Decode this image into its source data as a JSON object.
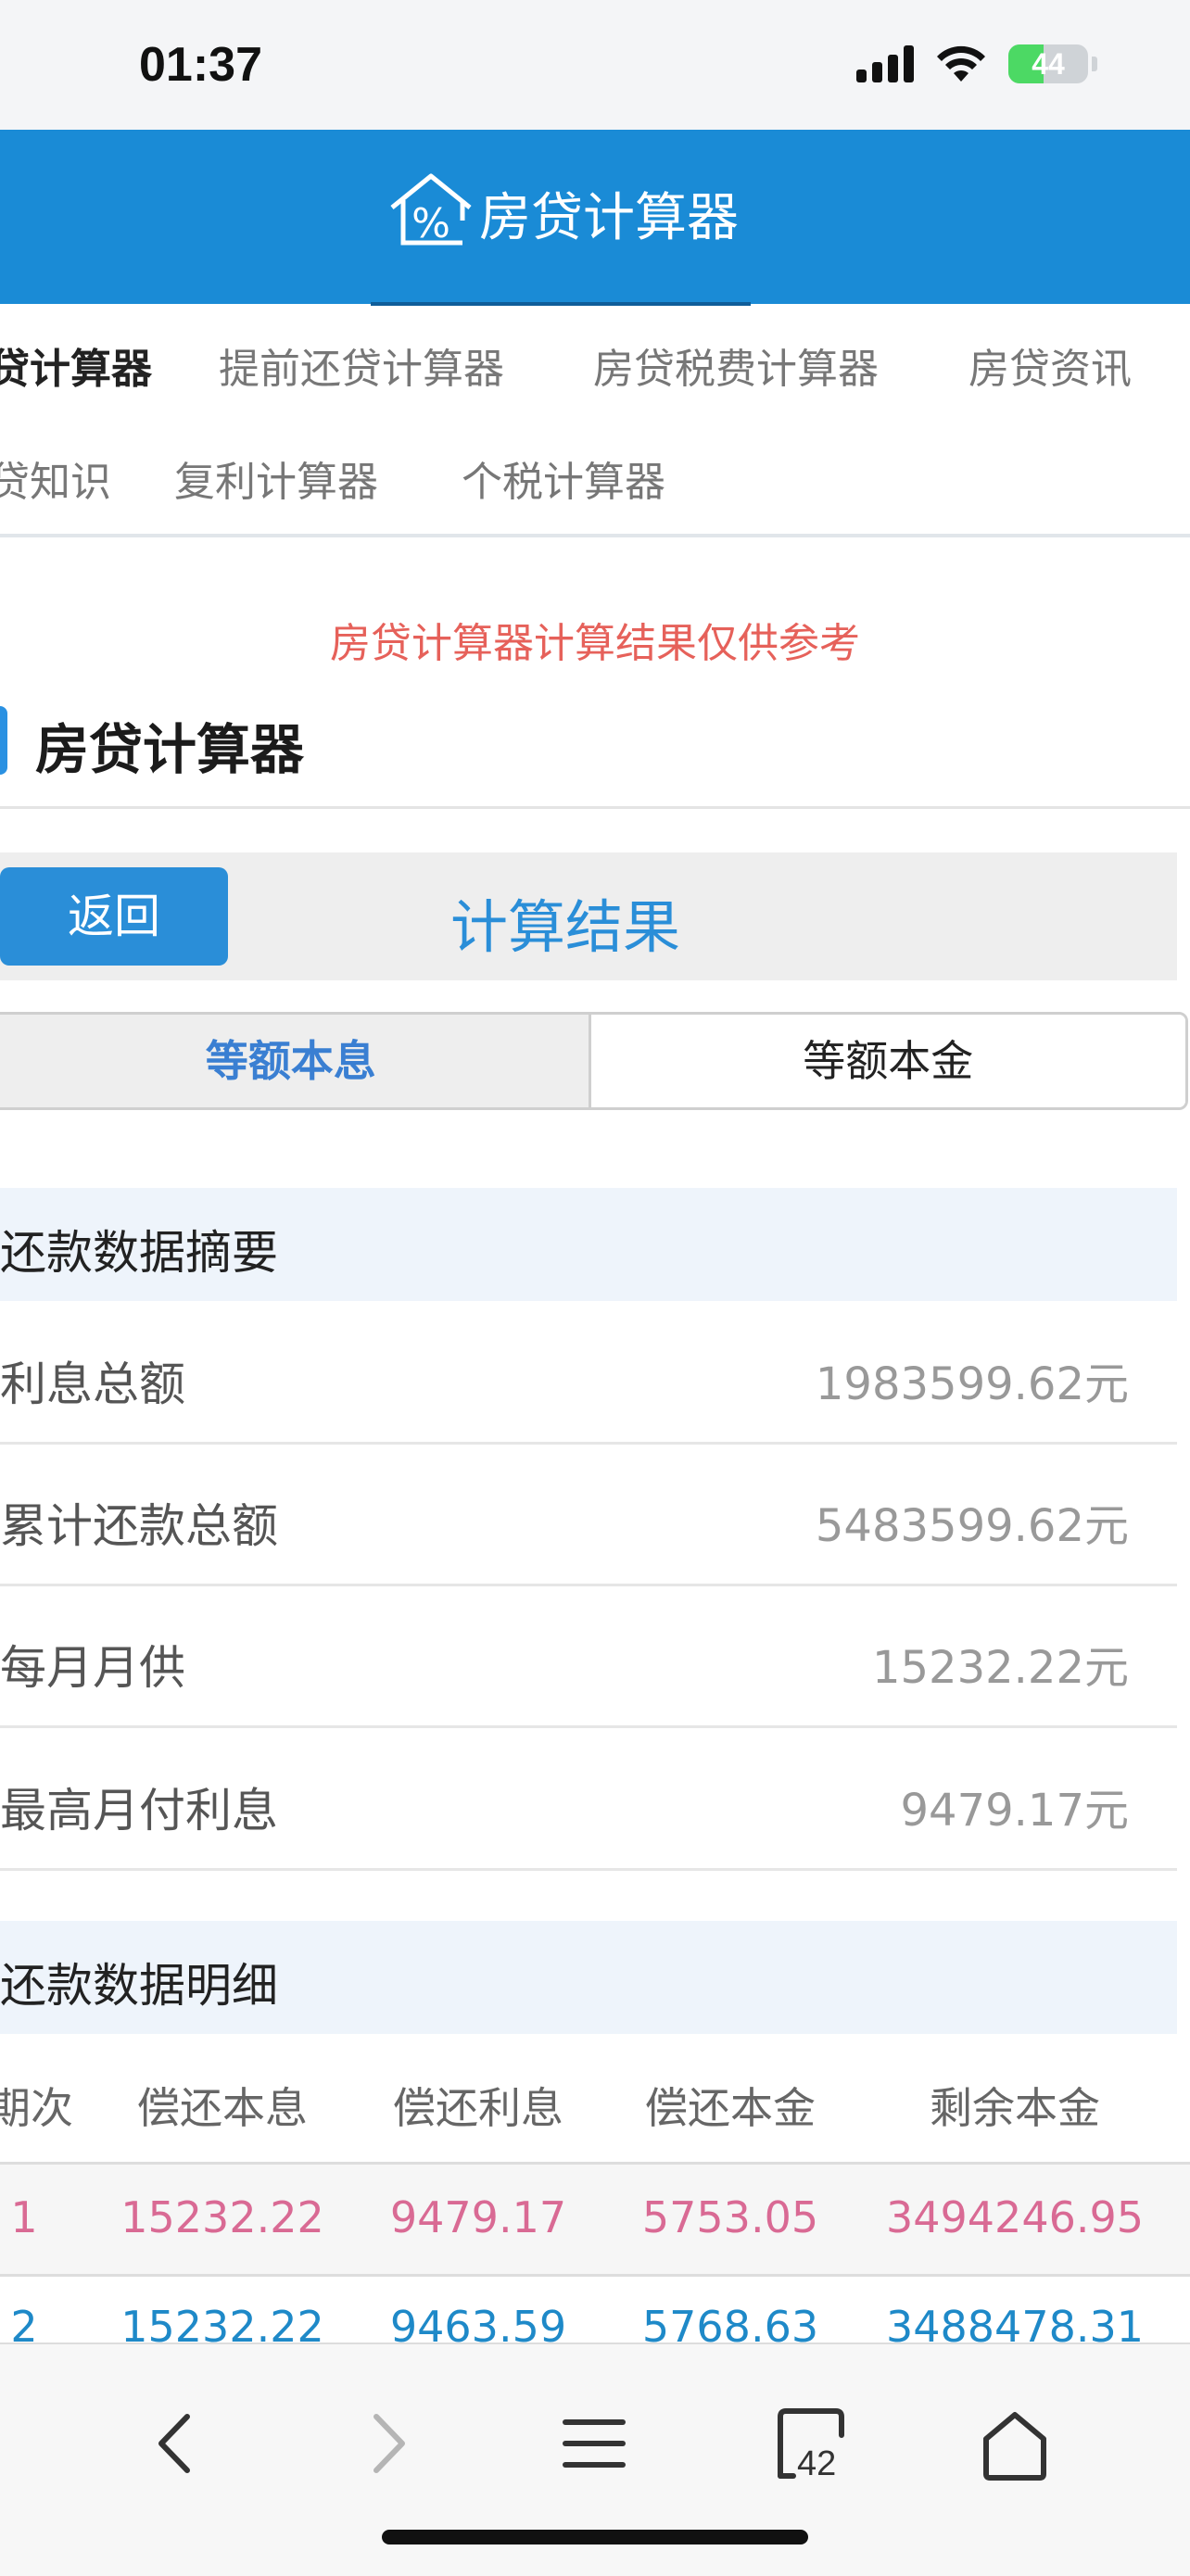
{
  "status_bar": {
    "time": "01:37",
    "battery": "44",
    "battery_level": 0.44
  },
  "header": {
    "title": "房贷计算器",
    "logo_icon": "house-percent-icon"
  },
  "nav": {
    "row1": [
      "贷计算器",
      "提前还贷计算器",
      "房贷税费计算器",
      "房贷资讯"
    ],
    "row2": [
      "贷知识",
      "复利计算器",
      "个税计算器"
    ]
  },
  "notice": "房贷计算器计算结果仅供参考",
  "section_title": "房贷计算器",
  "result_bar": {
    "back_label": "返回",
    "title": "计算结果"
  },
  "tabs": {
    "active": "等额本息",
    "inactive": "等额本金"
  },
  "summary": {
    "header": "还款数据摘要",
    "rows": [
      {
        "label": "利息总额",
        "value": "1983599.62元"
      },
      {
        "label": "累计还款总额",
        "value": "5483599.62元"
      },
      {
        "label": "每月月供",
        "value": "15232.22元"
      },
      {
        "label": "最高月付利息",
        "value": "9479.17元"
      }
    ]
  },
  "detail": {
    "header": "还款数据明细",
    "columns": [
      "期次",
      "偿还本息",
      "偿还利息",
      "偿还本金",
      "剩余本金"
    ],
    "rows": [
      [
        "1",
        "15232.22",
        "9479.17",
        "5753.05",
        "3494246.95"
      ],
      [
        "2",
        "15232.22",
        "9463.59",
        "5768.63",
        "3488478.31"
      ]
    ]
  },
  "toolbar": {
    "tabs_count": "42"
  },
  "colors": {
    "header_bg": "#1a8bd6",
    "accent": "#2a8ed8",
    "notice": "#e6615a",
    "row_pink": "#d96a94",
    "row_blue": "#1e89c8"
  }
}
